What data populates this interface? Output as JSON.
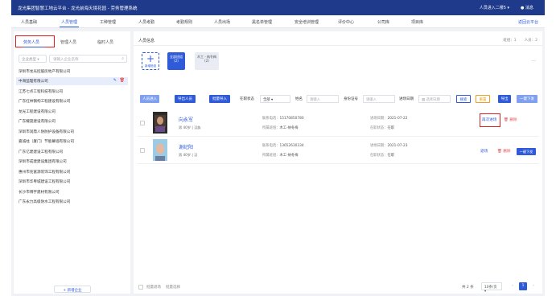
{
  "app": {
    "title": "龙光集团智慧工地云平台 - 龙光前海天境花园 - 劳务管理系统",
    "user": "人员进入二楼5 ▾",
    "message": "消息"
  },
  "nav": {
    "items": [
      "人员基础",
      "人员管理",
      "工种管理",
      "人员考勤",
      "考勤规则",
      "人员出场",
      "黑名单管理",
      "安全培训管理",
      "评价中心",
      "公司库",
      "项目库"
    ],
    "back": "返回云平台"
  },
  "left": {
    "tabs": [
      "劳务人员",
      "管理人员",
      "临时人员"
    ],
    "type_placeholder": "企业类型",
    "search_placeholder": "请输入企业名称",
    "companies": [
      "深圳市龙光控股房地产有限公司",
      "中海监理有限公司",
      "江苏七点工程科技有限公司",
      "广东红林钢构工程建设有限公司",
      "龙光工程建设有限公司",
      "广东耀晟建设有限公司",
      "深圳市润鼎人防防护设备有限公司",
      "嘉诚柱（厦门）节能幕墙有限公司",
      "广东亿建建设工程有限公司",
      "深圳市成建建设集团有限公司",
      "惠州市兆富源装饰工程有限公司",
      "深圳市华粤城建设工程有限公司",
      "长沙市博宇建材有限公司",
      "广东永力高级防水工程有限公司"
    ],
    "add_company": "+ 新增企业"
  },
  "right": {
    "title": "人员信息",
    "count_groups": "班组：1",
    "count_people": "人员：2",
    "add_group_label": "新增班组",
    "groups": [
      {
        "name": "全部班组",
        "count": "(2)"
      },
      {
        "name": "木工 - 纳冬梅",
        "count": "(2)"
      }
    ],
    "more": "···",
    "buttons": {
      "add_person": "人员进入",
      "batch_export": "导出人员",
      "batch_import": "批量导入",
      "search": "搜索",
      "reset": "重置",
      "export": "导出",
      "one_click": "一键下发"
    },
    "filters": {
      "status_label": "在职状态",
      "status_value": "全部",
      "name_label": "姓名",
      "name_placeholder": "请输入",
      "id_label": "身份证号",
      "id_placeholder": "请输入",
      "date_label": "进场日期",
      "date_placeholder": "选择日期"
    },
    "people": [
      {
        "name": "向永军",
        "meta": "男  40岁 | 汉族",
        "phone_label": "联系电话：",
        "phone": "15170850780",
        "group_label": "所属班组：",
        "group": "木工-纳冬梅",
        "entry_label": "进场日期：",
        "entry": "2021-07-22",
        "status_label": "在职状态：",
        "status": "在职",
        "action1": "再次进场",
        "action2": "删除"
      },
      {
        "name": "谢纪阳",
        "meta": "男  40岁 | 汉",
        "phone_label": "联系电话：",
        "phone": "13652630334",
        "group_label": "所属班组：",
        "group": "木工-纳冬梅",
        "entry_label": "进场日期：",
        "entry": "2021-07-23",
        "status_label": "在职状态：",
        "status": "在职",
        "action1": "退场",
        "action2": "删除",
        "action3": "一键下发"
      }
    ],
    "footer": {
      "batch_exit": "批量退场",
      "batch_select": "批量选择",
      "total": "共 2 条",
      "page_size": "10条/页 ▾",
      "prev": "‹",
      "page": "1",
      "next": "›"
    }
  }
}
